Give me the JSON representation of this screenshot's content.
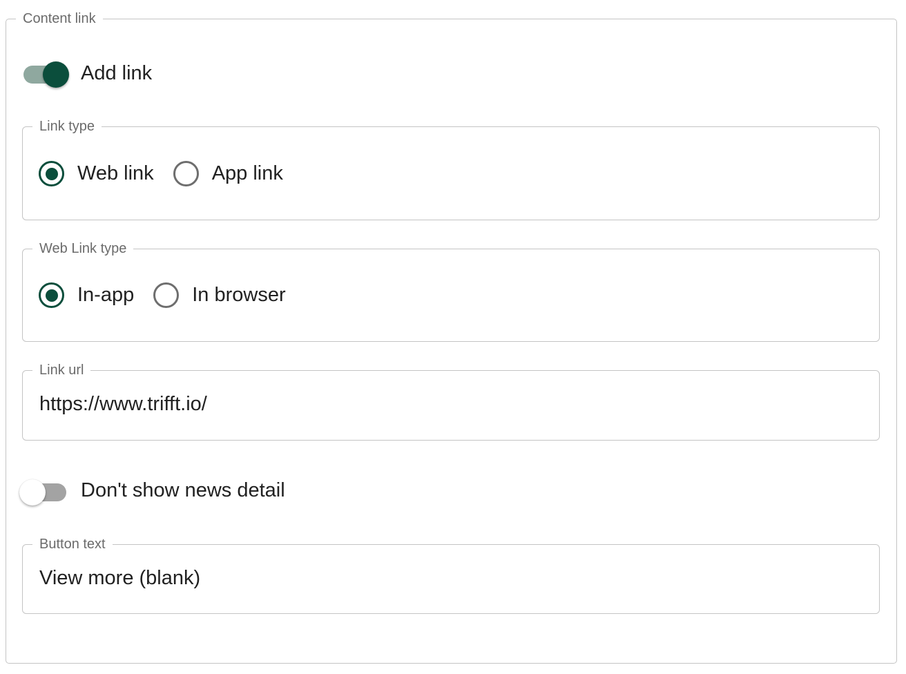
{
  "content_link": {
    "legend": "Content link",
    "add_link": {
      "label": "Add link",
      "on": true
    },
    "link_type": {
      "legend": "Link type",
      "options": [
        {
          "label": "Web link",
          "checked": true
        },
        {
          "label": "App link",
          "checked": false
        }
      ]
    },
    "web_link_type": {
      "legend": "Web Link type",
      "options": [
        {
          "label": "In-app",
          "checked": true
        },
        {
          "label": "In browser",
          "checked": false
        }
      ]
    },
    "link_url": {
      "legend": "Link url",
      "value": "https://www.trifft.io/"
    },
    "dont_show_news_detail": {
      "label": "Don't show news detail",
      "on": false
    },
    "button_text": {
      "legend": "Button text",
      "value": "View more (blank)"
    }
  },
  "colors": {
    "accent": "#0b4e3c",
    "track_on": "#8fa89f",
    "track_off": "#a3a3a3",
    "border": "#c4c4c4",
    "legend_text": "#6b6b6b"
  }
}
